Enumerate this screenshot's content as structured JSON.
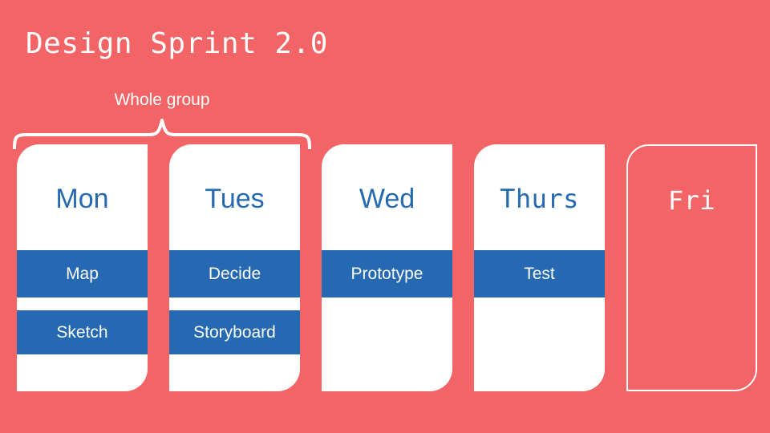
{
  "slide": {
    "title": "Design Sprint 2.0",
    "background_color": "#F26465",
    "accent_color": "#2469B2",
    "card_color": "#ffffff"
  },
  "bracket": {
    "label": "Whole group",
    "spans_days": [
      "Mon",
      "Tues"
    ]
  },
  "days": [
    {
      "name": "Mon",
      "name_font": "sans",
      "card_style": "filled",
      "phases": [
        "Map",
        "Sketch"
      ]
    },
    {
      "name": "Tues",
      "name_font": "sans",
      "card_style": "filled",
      "phases": [
        "Decide",
        "Storyboard"
      ]
    },
    {
      "name": "Wed",
      "name_font": "sans",
      "card_style": "filled",
      "phases": [
        "Prototype"
      ]
    },
    {
      "name": "Thurs",
      "name_font": "mono",
      "card_style": "filled",
      "phases": [
        "Test"
      ]
    },
    {
      "name": "Fri",
      "name_font": "mono",
      "card_style": "outlined",
      "phases": []
    }
  ]
}
